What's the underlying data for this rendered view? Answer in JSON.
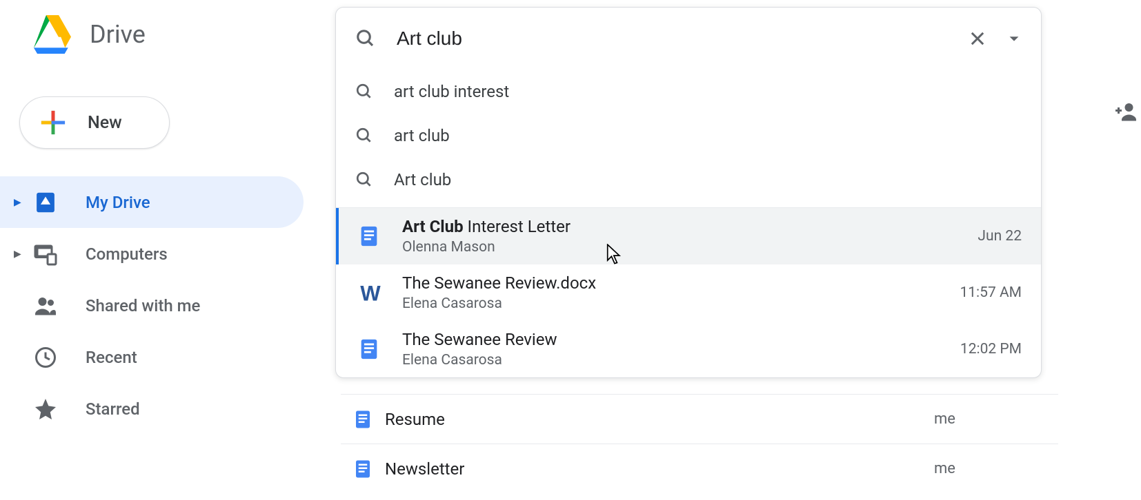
{
  "app": {
    "name": "Drive"
  },
  "new_button": {
    "label": "New"
  },
  "sidebar": {
    "items": [
      {
        "label": "My Drive",
        "active": true,
        "expandable": true
      },
      {
        "label": "Computers",
        "active": false,
        "expandable": true
      },
      {
        "label": "Shared with me",
        "active": false,
        "expandable": false
      },
      {
        "label": "Recent",
        "active": false,
        "expandable": false
      },
      {
        "label": "Starred",
        "active": false,
        "expandable": false
      }
    ]
  },
  "search": {
    "value": "Art club",
    "suggestions": [
      "art club interest",
      "art club",
      "Art club"
    ],
    "file_results": [
      {
        "title_bold": "Art Club",
        "title_rest": " Interest Letter",
        "owner": "Olenna Mason",
        "date": "Jun 22",
        "icon": "docs",
        "hover": true
      },
      {
        "title_bold": "",
        "title_rest": "The Sewanee Review.docx",
        "owner": "Elena Casarosa",
        "date": "11:57 AM",
        "icon": "word",
        "hover": false
      },
      {
        "title_bold": "",
        "title_rest": "The Sewanee Review",
        "owner": "Elena Casarosa",
        "date": "12:02 PM",
        "icon": "docs",
        "hover": false
      }
    ]
  },
  "main_files": [
    {
      "title": "Resume",
      "owner": "me",
      "icon": "docs"
    },
    {
      "title": "Newsletter",
      "owner": "me",
      "icon": "docs"
    }
  ]
}
